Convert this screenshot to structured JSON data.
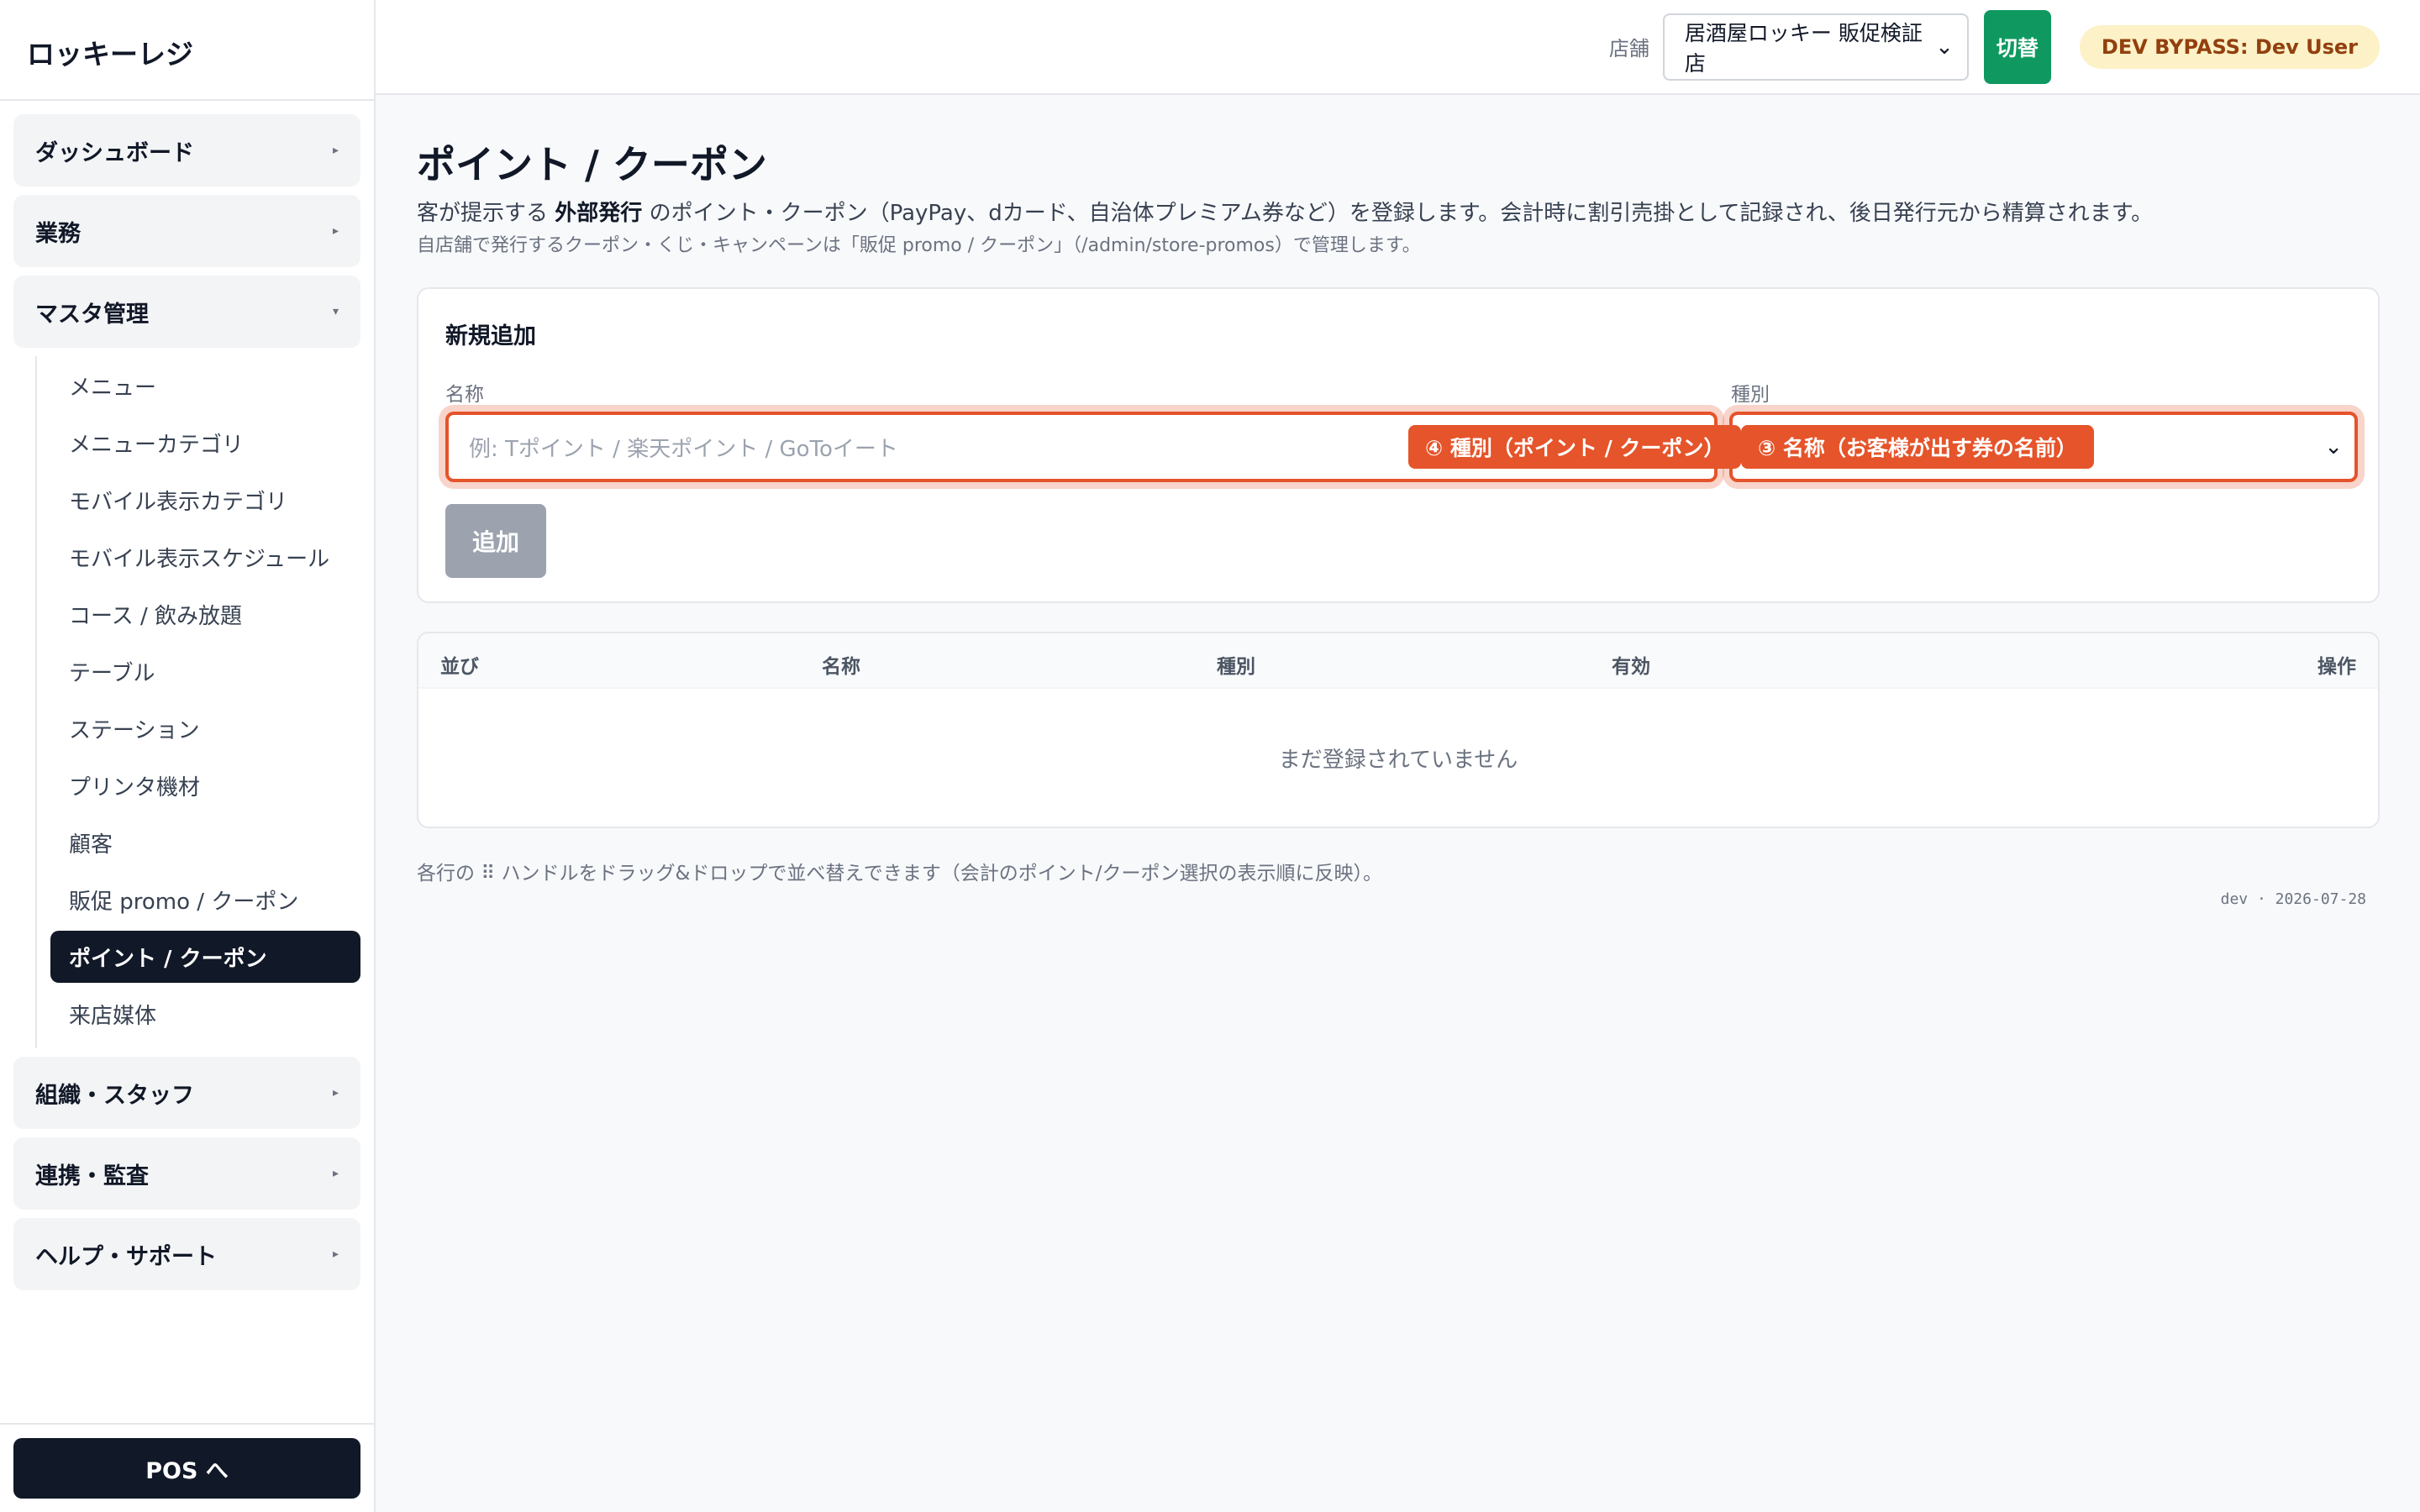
{
  "app": {
    "title": "ロッキーレジ"
  },
  "sidebar": {
    "groups": [
      {
        "label": "ダッシュボード",
        "caret": "▸"
      },
      {
        "label": "業務",
        "caret": "▸"
      },
      {
        "label": "マスタ管理",
        "caret": "▾"
      },
      {
        "label": "組織・スタッフ",
        "caret": "▸"
      },
      {
        "label": "連携・監査",
        "caret": "▸"
      },
      {
        "label": "ヘルプ・サポート",
        "caret": "▸"
      }
    ],
    "master_items": [
      "メニュー",
      "メニューカテゴリ",
      "モバイル表示カテゴリ",
      "モバイル表示スケジュール",
      "コース / 飲み放題",
      "テーブル",
      "ステーション",
      "プリンタ機材",
      "顧客",
      "販促 promo / クーポン",
      "ポイント / クーポン",
      "来店媒体"
    ],
    "pos_button": "POS へ"
  },
  "header": {
    "store_label": "店舗",
    "store_value": "居酒屋ロッキー 販促検証店",
    "store_chevron": "⌄",
    "switch_label": "切替",
    "dev_badge": "DEV BYPASS: Dev User"
  },
  "page": {
    "title": "ポイント / クーポン",
    "desc_pre": "客が提示する",
    "desc_bold": "外部発行",
    "desc_post": "のポイント・クーポン（PayPay、dカード、自治体プレミアム券など）を登録します。会計時に割引売掛として記録され、後日発行元から精算されます。",
    "note": "自店舗で発行するクーポン・くじ・キャンペーンは「販促 promo / クーポン」（/admin/store-promos）で管理します。"
  },
  "form": {
    "title": "新規追加",
    "name_label": "名称",
    "name_placeholder": "例: Tポイント / 楽天ポイント / GoToイート",
    "type_label": "種別",
    "type_chevron": "⌄",
    "tag_name_field": "④ 種別（ポイント / クーポン）",
    "tag_type_field": "③ 名称（お客様が出す券の名前）",
    "add_button": "追加"
  },
  "table": {
    "headers": [
      "並び",
      "名称",
      "種別",
      "有効",
      "操作"
    ],
    "empty_text": "まだ登録されていません"
  },
  "hint": "各行の ⠿ ハンドルをドラッグ&ドロップで並べ替えできます（会計のポイント/クーポン選択の表示順に反映）。",
  "meta": "dev · 2026-07-28"
}
